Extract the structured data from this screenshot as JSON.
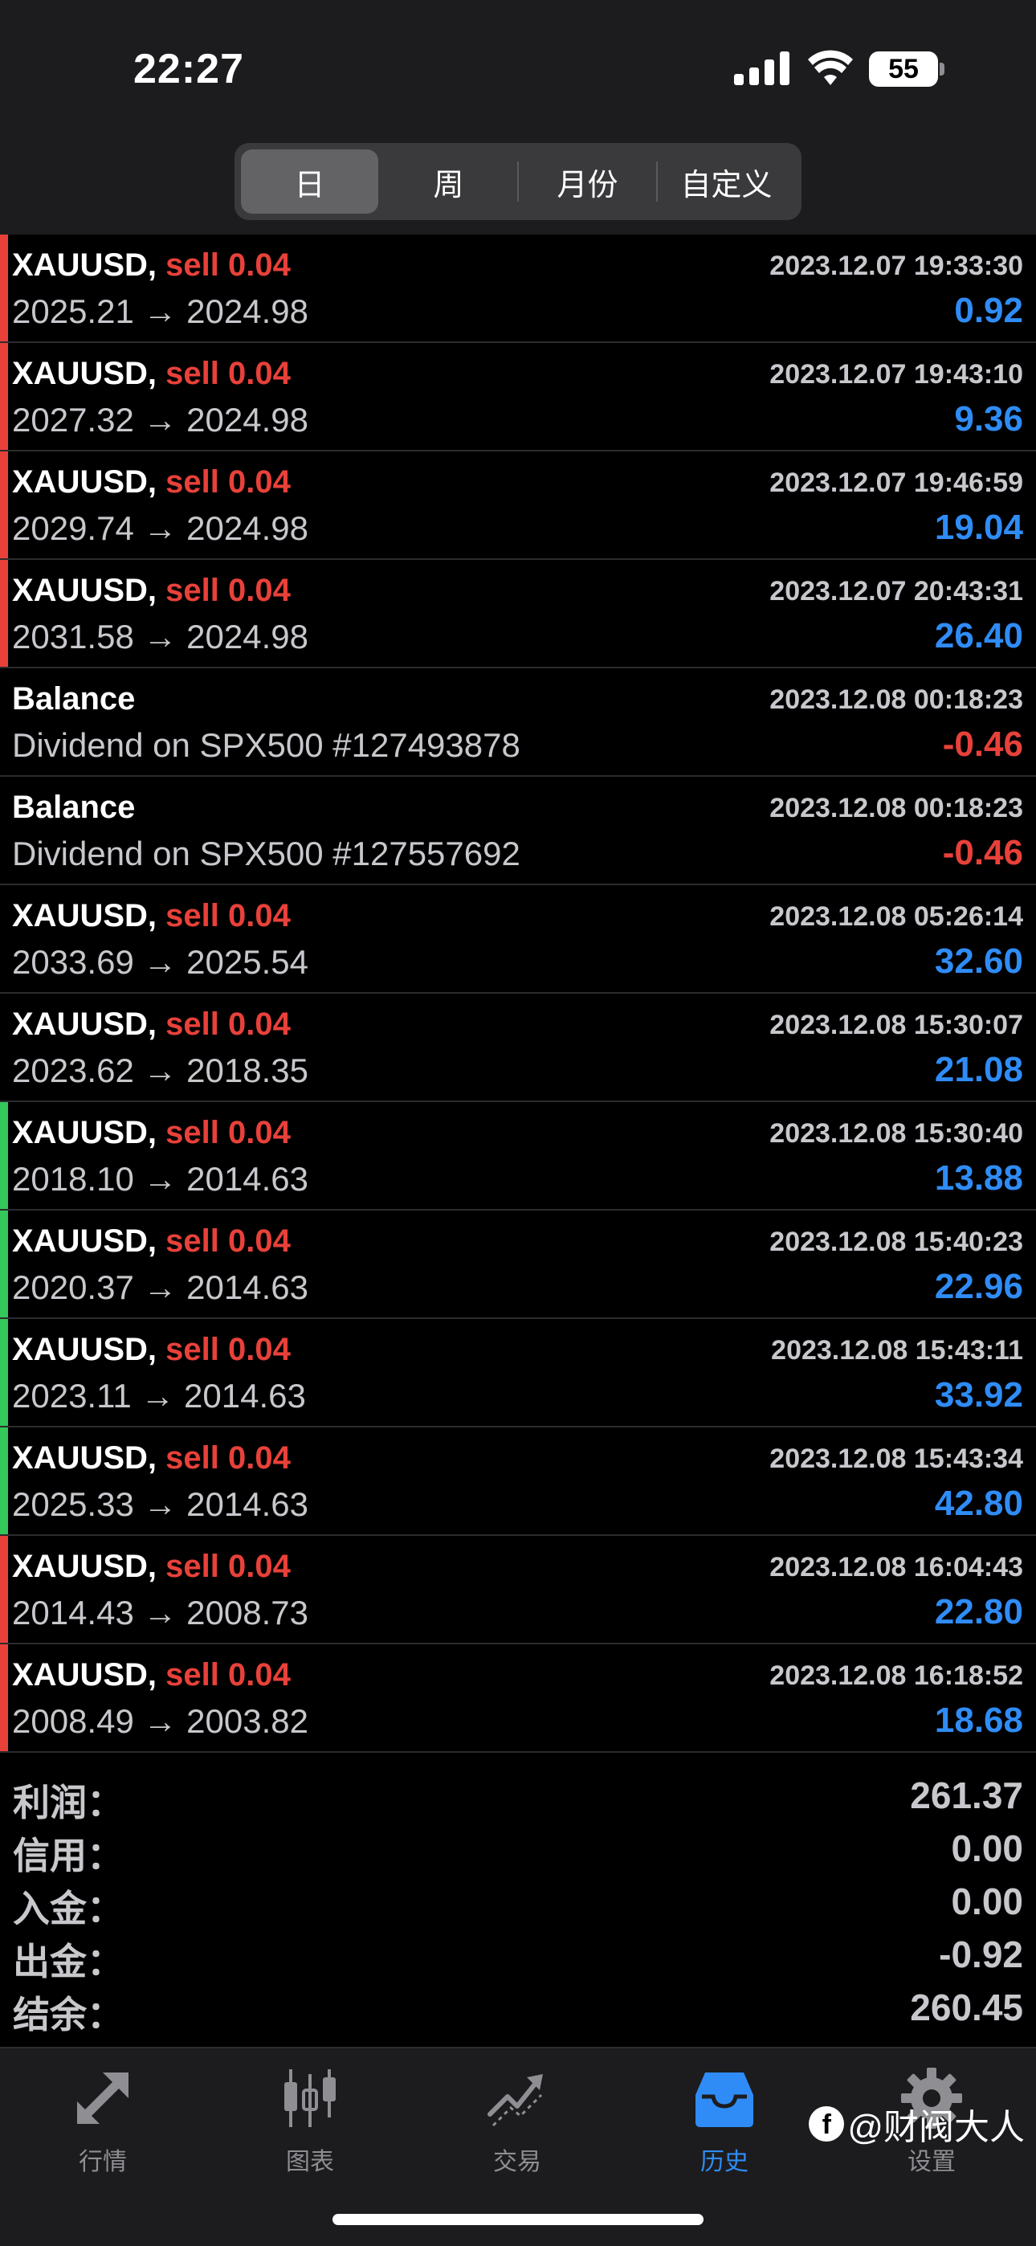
{
  "status_bar": {
    "time": "22:27",
    "battery": "55"
  },
  "segments": [
    {
      "label": "日",
      "active": true
    },
    {
      "label": "周",
      "active": false
    },
    {
      "label": "月份",
      "active": false
    },
    {
      "label": "自定义",
      "active": false
    }
  ],
  "colors": {
    "profit_positive": "#2f8cf6",
    "profit_negative": "#e8413a",
    "sell": "#e8413a",
    "bar_red": "#e8413a",
    "bar_green": "#34c759"
  },
  "deals": [
    {
      "symbol": "XAUUSD,",
      "action": "sell 0.04",
      "prices": "2025.21 → 2024.98",
      "time": "2023.12.07 19:33:30",
      "profit": "0.92",
      "bar": "red",
      "sign": "pos"
    },
    {
      "symbol": "XAUUSD,",
      "action": "sell 0.04",
      "prices": "2027.32 → 2024.98",
      "time": "2023.12.07 19:43:10",
      "profit": "9.36",
      "bar": "red",
      "sign": "pos"
    },
    {
      "symbol": "XAUUSD,",
      "action": "sell 0.04",
      "prices": "2029.74 → 2024.98",
      "time": "2023.12.07 19:46:59",
      "profit": "19.04",
      "bar": "red",
      "sign": "pos"
    },
    {
      "symbol": "XAUUSD,",
      "action": "sell 0.04",
      "prices": "2031.58 → 2024.98",
      "time": "2023.12.07 20:43:31",
      "profit": "26.40",
      "bar": "red",
      "sign": "pos"
    },
    {
      "symbol": "Balance",
      "action": "",
      "prices": "Dividend on SPX500 #127493878",
      "time": "2023.12.08 00:18:23",
      "profit": "-0.46",
      "bar": "none",
      "sign": "neg"
    },
    {
      "symbol": "Balance",
      "action": "",
      "prices": "Dividend on SPX500 #127557692",
      "time": "2023.12.08 00:18:23",
      "profit": "-0.46",
      "bar": "none",
      "sign": "neg"
    },
    {
      "symbol": "XAUUSD,",
      "action": "sell 0.04",
      "prices": "2033.69 → 2025.54",
      "time": "2023.12.08 05:26:14",
      "profit": "32.60",
      "bar": "none",
      "sign": "pos"
    },
    {
      "symbol": "XAUUSD,",
      "action": "sell 0.04",
      "prices": "2023.62 → 2018.35",
      "time": "2023.12.08 15:30:07",
      "profit": "21.08",
      "bar": "none",
      "sign": "pos"
    },
    {
      "symbol": "XAUUSD,",
      "action": "sell 0.04",
      "prices": "2018.10 → 2014.63",
      "time": "2023.12.08 15:30:40",
      "profit": "13.88",
      "bar": "green",
      "sign": "pos"
    },
    {
      "symbol": "XAUUSD,",
      "action": "sell 0.04",
      "prices": "2020.37 → 2014.63",
      "time": "2023.12.08 15:40:23",
      "profit": "22.96",
      "bar": "green",
      "sign": "pos"
    },
    {
      "symbol": "XAUUSD,",
      "action": "sell 0.04",
      "prices": "2023.11 → 2014.63",
      "time": "2023.12.08 15:43:11",
      "profit": "33.92",
      "bar": "green",
      "sign": "pos"
    },
    {
      "symbol": "XAUUSD,",
      "action": "sell 0.04",
      "prices": "2025.33 → 2014.63",
      "time": "2023.12.08 15:43:34",
      "profit": "42.80",
      "bar": "green",
      "sign": "pos"
    },
    {
      "symbol": "XAUUSD,",
      "action": "sell 0.04",
      "prices": "2014.43 → 2008.73",
      "time": "2023.12.08 16:04:43",
      "profit": "22.80",
      "bar": "red",
      "sign": "pos"
    },
    {
      "symbol": "XAUUSD,",
      "action": "sell 0.04",
      "prices": "2008.49 → 2003.82",
      "time": "2023.12.08 16:18:52",
      "profit": "18.68",
      "bar": "red",
      "sign": "pos"
    }
  ],
  "summary": [
    {
      "label": "利润：",
      "value": "261.37"
    },
    {
      "label": "信用：",
      "value": "0.00"
    },
    {
      "label": "入金：",
      "value": "0.00"
    },
    {
      "label": "出金：",
      "value": "-0.92"
    },
    {
      "label": "结余：",
      "value": "260.45"
    }
  ],
  "tabs": [
    {
      "label": "行情",
      "icon": "quotes-arrows-icon",
      "active": false
    },
    {
      "label": "图表",
      "icon": "candlestick-chart-icon",
      "active": false
    },
    {
      "label": "交易",
      "icon": "trade-chart-icon",
      "active": false
    },
    {
      "label": "历史",
      "icon": "history-inbox-icon",
      "active": true
    },
    {
      "label": "设置",
      "icon": "gear-icon",
      "active": false
    }
  ],
  "watermark": "@财阀大人"
}
